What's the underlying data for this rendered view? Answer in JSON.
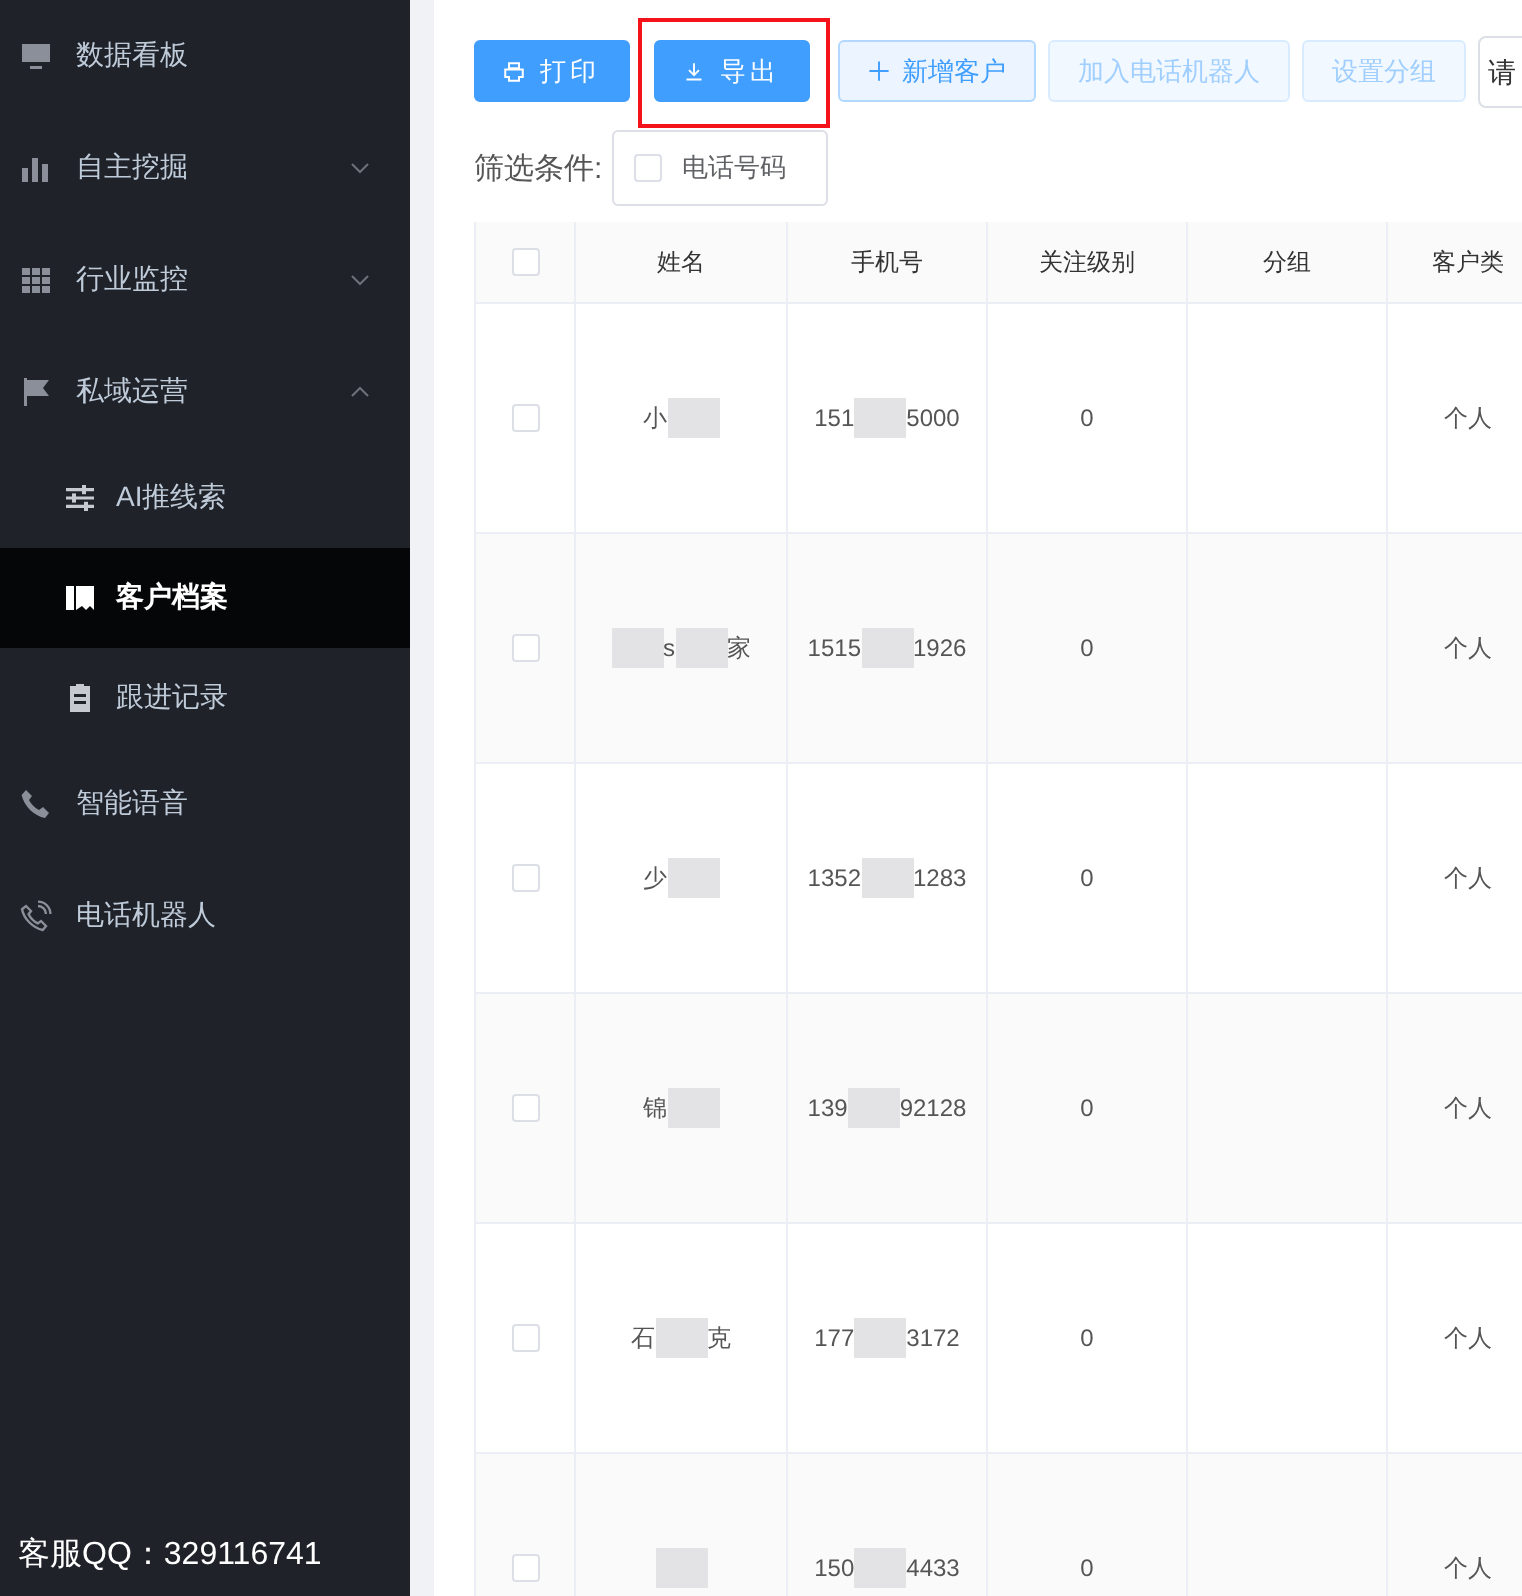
{
  "sidebar": {
    "items": [
      {
        "label": "数据看板"
      },
      {
        "label": "自主挖掘",
        "expanded": false
      },
      {
        "label": "行业监控",
        "expanded": false
      },
      {
        "label": "私域运营",
        "expanded": true,
        "children": [
          {
            "label": "AI推线索",
            "selected": false
          },
          {
            "label": "客户档案",
            "selected": true
          },
          {
            "label": "跟进记录",
            "selected": false
          }
        ]
      },
      {
        "label": "智能语音"
      },
      {
        "label": "电话机器人"
      }
    ],
    "footer": "客服QQ：329116741"
  },
  "toolbar": {
    "buttons": [
      {
        "label": "打印",
        "kind": "primary",
        "highlighted": false
      },
      {
        "label": "导出",
        "kind": "primary",
        "highlighted": true
      },
      {
        "label": "新增客户",
        "kind": "plain",
        "highlighted": false
      },
      {
        "label": "加入电话机器人",
        "kind": "disabled",
        "highlighted": false
      },
      {
        "label": "设置分组",
        "kind": "disabled",
        "highlighted": false
      }
    ],
    "search": {
      "placeholder": "请"
    }
  },
  "filter": {
    "label": "筛选条件:",
    "options": [
      {
        "label": "电话号码",
        "checked": false
      }
    ]
  },
  "table": {
    "select_all": false,
    "columns": [
      "姓名",
      "手机号",
      "关注级别",
      "分组",
      "客户类"
    ],
    "rows": [
      {
        "selected": false,
        "name": [
          {
            "kind": "text",
            "text": "小"
          },
          {
            "kind": "redacted"
          }
        ],
        "phone": [
          {
            "kind": "text",
            "text": "151"
          },
          {
            "kind": "redacted"
          },
          {
            "kind": "text",
            "text": "5000"
          }
        ],
        "level": "0",
        "type": "个人"
      },
      {
        "selected": false,
        "name": [
          {
            "kind": "redacted"
          },
          {
            "kind": "text",
            "text": "s"
          },
          {
            "kind": "redacted"
          },
          {
            "kind": "text",
            "text": "家"
          }
        ],
        "phone": [
          {
            "kind": "text",
            "text": "1515"
          },
          {
            "kind": "redacted"
          },
          {
            "kind": "text",
            "text": "1926"
          }
        ],
        "level": "0",
        "type": "个人"
      },
      {
        "selected": false,
        "name": [
          {
            "kind": "text",
            "text": "少"
          },
          {
            "kind": "redacted"
          }
        ],
        "phone": [
          {
            "kind": "text",
            "text": "1352"
          },
          {
            "kind": "redacted"
          },
          {
            "kind": "text",
            "text": "1283"
          }
        ],
        "level": "0",
        "type": "个人"
      },
      {
        "selected": false,
        "name": [
          {
            "kind": "text",
            "text": "锦"
          },
          {
            "kind": "redacted"
          }
        ],
        "phone": [
          {
            "kind": "text",
            "text": "139"
          },
          {
            "kind": "redacted"
          },
          {
            "kind": "text",
            "text": "92128"
          }
        ],
        "level": "0",
        "type": "个人"
      },
      {
        "selected": false,
        "name": [
          {
            "kind": "text",
            "text": "石"
          },
          {
            "kind": "redacted"
          },
          {
            "kind": "text",
            "text": "克"
          }
        ],
        "phone": [
          {
            "kind": "text",
            "text": "177"
          },
          {
            "kind": "redacted"
          },
          {
            "kind": "text",
            "text": "3172"
          }
        ],
        "level": "0",
        "type": "个人"
      },
      {
        "selected": false,
        "name": [
          {
            "kind": "redacted"
          }
        ],
        "phone": [
          {
            "kind": "text",
            "text": "150"
          },
          {
            "kind": "redacted"
          },
          {
            "kind": "text",
            "text": "4433"
          }
        ],
        "level": "0",
        "type": "个人"
      }
    ]
  }
}
